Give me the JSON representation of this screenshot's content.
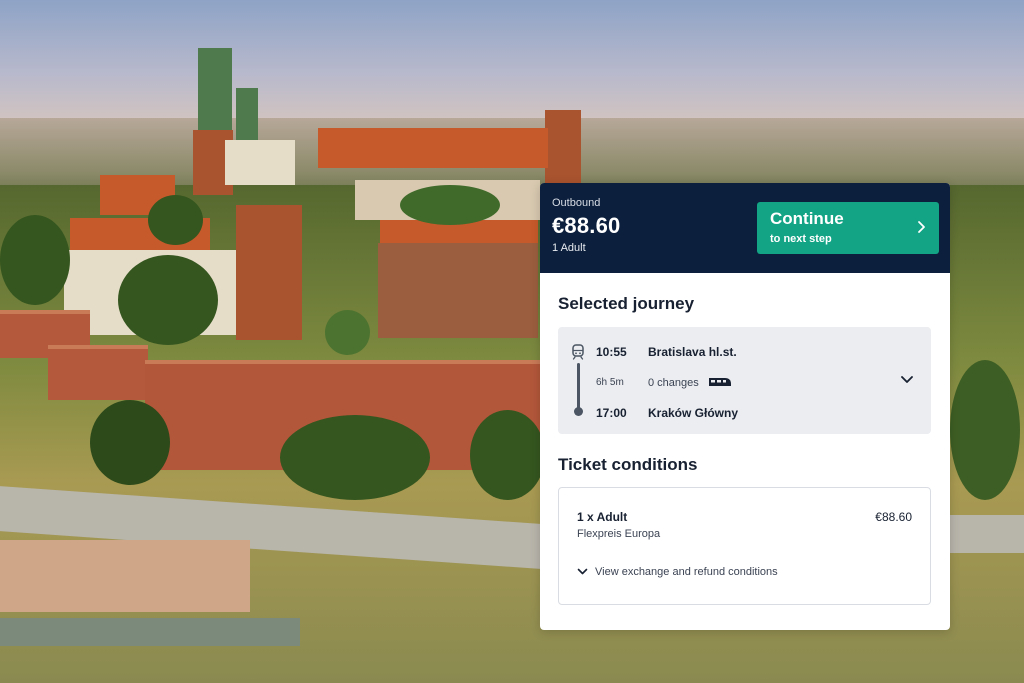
{
  "header": {
    "outbound_label": "Outbound",
    "price": "€88.60",
    "passengers": "1 Adult",
    "continue_label": "Continue",
    "continue_sublabel": "to next step"
  },
  "journey": {
    "section_title": "Selected journey",
    "departure_time": "10:55",
    "departure_station": "Bratislava hl.st.",
    "duration": "6h 5m",
    "changes": "0 changes",
    "arrival_time": "17:00",
    "arrival_station": "Kraków Główny"
  },
  "ticket": {
    "section_title": "Ticket conditions",
    "item": "1 x Adult",
    "price": "€88.60",
    "fare_name": "Flexpreis Europa",
    "conditions_link": "View exchange and refund conditions"
  },
  "icons": {
    "continue": "chevron-right-icon",
    "rail": "train-front-icon",
    "train": "train-side-icon",
    "expand": "chevron-down-icon",
    "conditions": "chevron-down-icon"
  },
  "colors": {
    "header_bg": "#0c1f3c",
    "accent": "#13a385",
    "journey_bg": "#ebedf0"
  }
}
